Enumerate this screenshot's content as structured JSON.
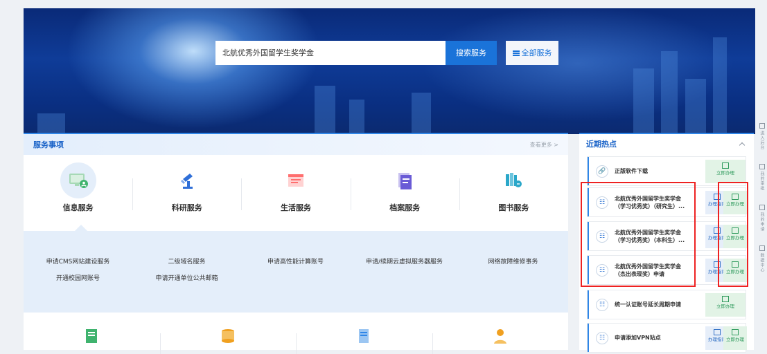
{
  "search": {
    "value": "北航优秀外国留学生奖学金",
    "button": "搜索服务",
    "all_services": "全部服务"
  },
  "services": {
    "title": "服务事项",
    "more": "查看更多 >",
    "categories": [
      {
        "label": "信息服务",
        "icon": "monitor-user-icon",
        "color": "#3fb36e"
      },
      {
        "label": "科研服务",
        "icon": "microscope-icon",
        "color": "#2f6fd8"
      },
      {
        "label": "生活服务",
        "icon": "id-card-icon",
        "color": "#ff6f6f"
      },
      {
        "label": "档案服务",
        "icon": "archive-icon",
        "color": "#6a5bd6"
      },
      {
        "label": "图书服务",
        "icon": "books-icon",
        "color": "#2aa7c9"
      }
    ],
    "links_row1": [
      "申请CMS网站建设服务",
      "二级域名服务",
      "申请高性能计算账号",
      "申请/续期云虚拟服务器服务",
      "网络故障维修事务"
    ],
    "links_row2": [
      "开通校园网账号",
      "申请开通单位公共邮箱"
    ],
    "categories2": [
      {
        "icon": "document-icon",
        "color": "#3fb36e"
      },
      {
        "icon": "database-icon",
        "color": "#f0a020"
      },
      {
        "icon": "file-list-icon",
        "color": "#2f86e8"
      },
      {
        "icon": "person-icon",
        "color": "#f0a020"
      }
    ]
  },
  "hot": {
    "title": "近期热点",
    "items": [
      {
        "line1": "正版软件下载",
        "line2": "",
        "icon": "link-icon",
        "guide": "",
        "go": "立即办理"
      },
      {
        "line1": "北航优秀外国留学生奖学金",
        "line2": "（学习优秀奖）（研究生）...",
        "icon": "org-chart-icon",
        "guide": "办理指南",
        "go": "立即办理"
      },
      {
        "line1": "北航优秀外国留学生奖学金",
        "line2": "（学习优秀奖）（本科生）...",
        "icon": "org-chart-icon",
        "guide": "办理指南",
        "go": "立即办理"
      },
      {
        "line1": "北航优秀外国留学生奖学金",
        "line2": "（杰出表现奖）申请",
        "icon": "org-chart-icon",
        "guide": "办理指南",
        "go": "立即办理"
      },
      {
        "line1": "统一认证账号延长周期申请",
        "line2": "",
        "icon": "org-chart-icon",
        "guide": "",
        "go": "立即办理"
      },
      {
        "line1": "申请添加VPN站点",
        "line2": "",
        "icon": "org-chart-icon",
        "guide": "办理指南",
        "go": "立即办理"
      }
    ]
  },
  "sidebar": [
    "进入后台",
    "我的审批",
    "我的申请",
    "数据中心"
  ],
  "colors": {
    "accent": "#1a73d9",
    "highlight": "#ee2222"
  }
}
